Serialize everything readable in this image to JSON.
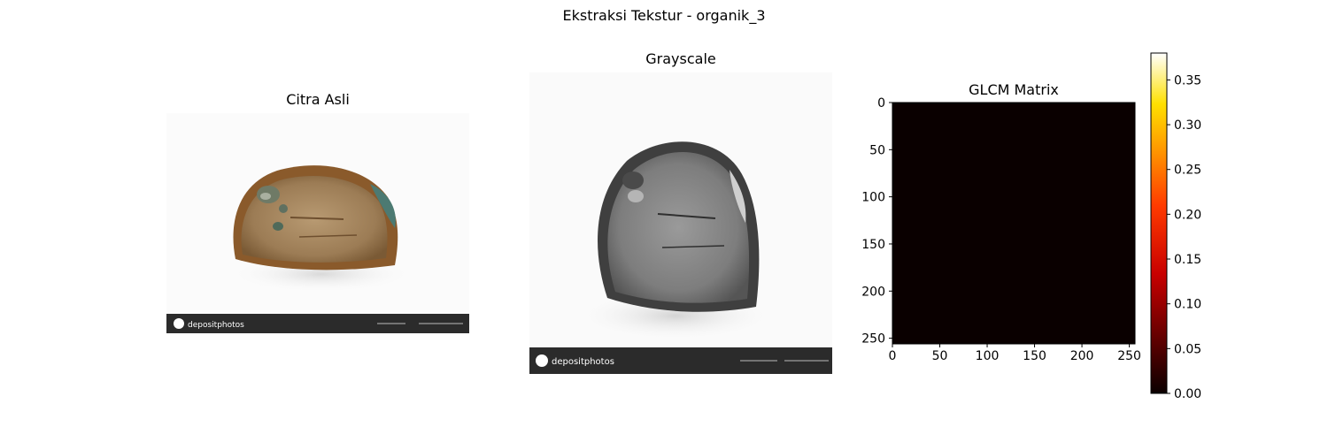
{
  "figure": {
    "title": "Ekstraksi Tekstur - organik_3"
  },
  "panels": {
    "original": {
      "title": "Citra Asli",
      "watermark": "depositphotos"
    },
    "grayscale": {
      "title": "Grayscale",
      "watermark": "depositphotos"
    }
  },
  "chart_data": {
    "type": "heatmap",
    "title": "GLCM Matrix",
    "x_ticks": [
      0,
      50,
      100,
      150,
      200,
      250
    ],
    "y_ticks": [
      0,
      50,
      100,
      150,
      200,
      250
    ],
    "xlim": [
      0,
      256
    ],
    "ylim": [
      256,
      0
    ],
    "colormap": "hot",
    "colorbar": {
      "range": [
        0.0,
        0.38
      ],
      "ticks": [
        "0.00",
        "0.05",
        "0.10",
        "0.15",
        "0.20",
        "0.25",
        "0.30",
        "0.35"
      ],
      "tick_values": [
        0.0,
        0.05,
        0.1,
        0.15,
        0.2,
        0.25,
        0.3,
        0.35
      ]
    },
    "matrix_note_color": "#0a0000"
  },
  "colors": {
    "heatmap_fill": "#0a0000",
    "watermark_bar": "#2b2b2b"
  }
}
